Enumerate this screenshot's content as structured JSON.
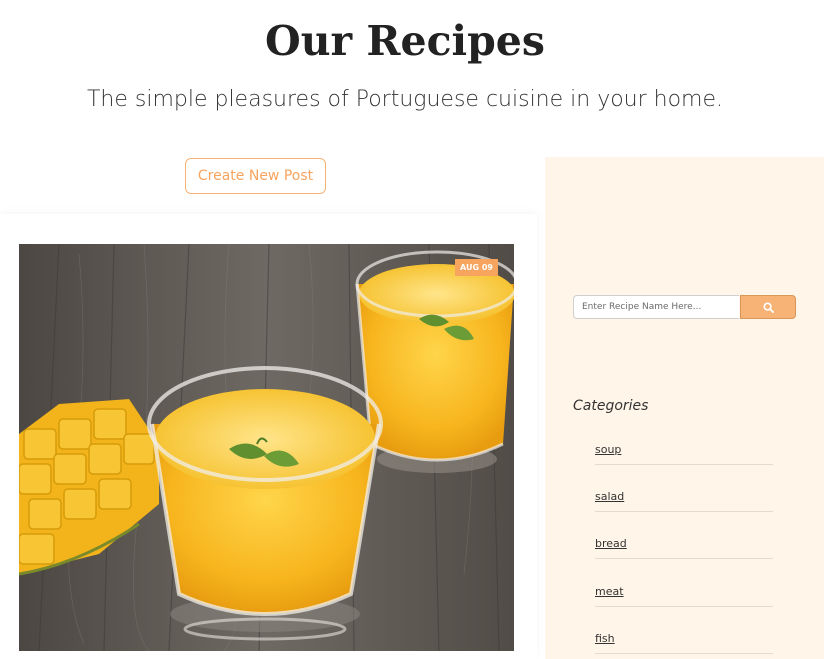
{
  "header": {
    "title": "Our Recipes",
    "subtitle": "The simple pleasures of Portuguese cuisine in your home."
  },
  "actions": {
    "create_post_label": "Create New Post"
  },
  "post": {
    "date_badge": "AUG 09",
    "image_subject": "mango smoothie glasses with mint on wooden table"
  },
  "sidebar": {
    "search": {
      "placeholder": "Enter Recipe Name Here...",
      "button_icon": "search-icon"
    },
    "categories_heading": "Categories",
    "categories": [
      {
        "label": "soup"
      },
      {
        "label": "salad"
      },
      {
        "label": "bread"
      },
      {
        "label": "meat"
      },
      {
        "label": "fish"
      }
    ]
  },
  "colors": {
    "accent": "#f7a45e",
    "sidebar_bg": "#fff5e8",
    "text": "#222222"
  }
}
